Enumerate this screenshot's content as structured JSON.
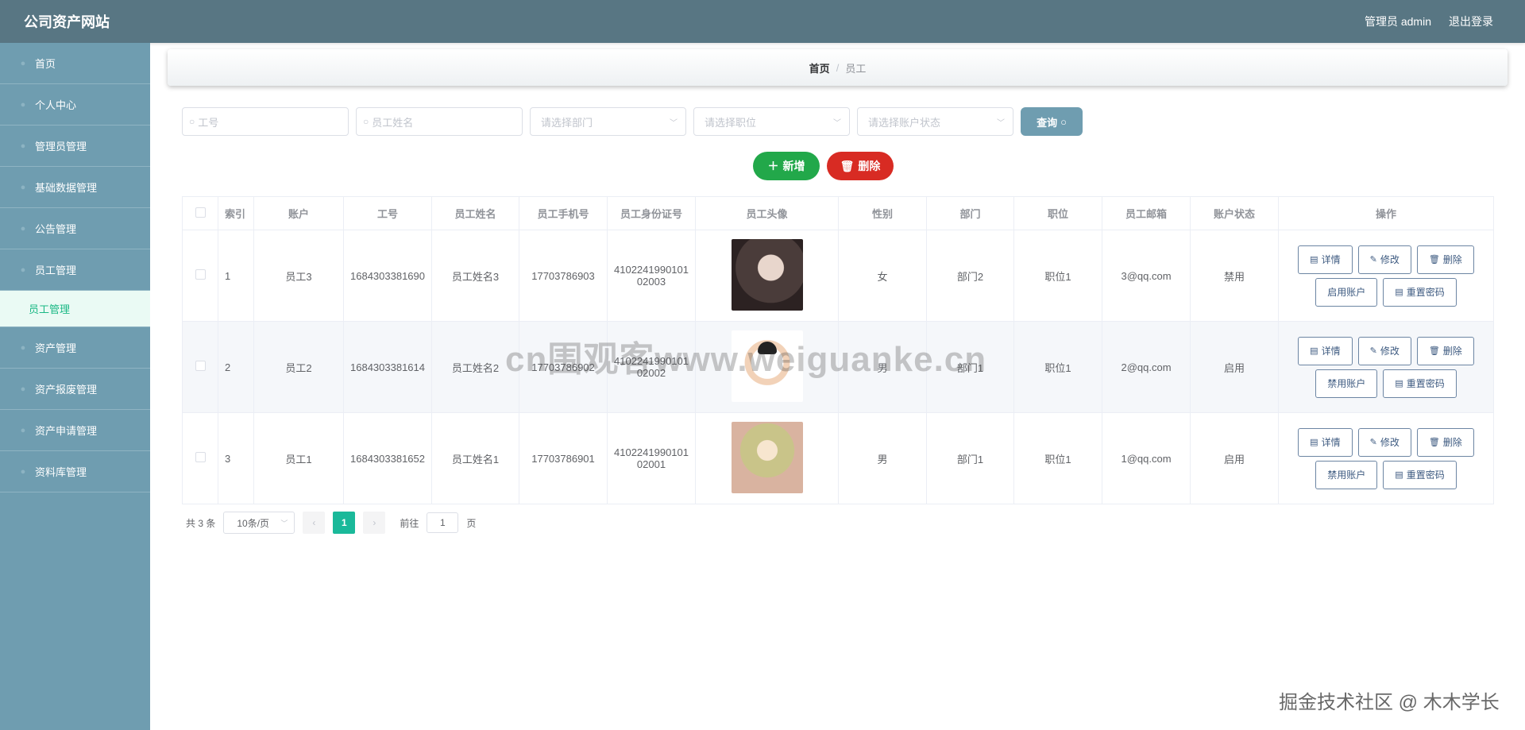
{
  "header": {
    "title": "公司资产网站",
    "user_label": "管理员 admin",
    "logout_label": "退出登录"
  },
  "sidebar": {
    "items": [
      {
        "label": "首页"
      },
      {
        "label": "个人中心"
      },
      {
        "label": "管理员管理"
      },
      {
        "label": "基础数据管理"
      },
      {
        "label": "公告管理"
      },
      {
        "label": "员工管理"
      },
      {
        "label": "员工管理",
        "sub": true
      },
      {
        "label": "资产管理"
      },
      {
        "label": "资产报废管理"
      },
      {
        "label": "资产申请管理"
      },
      {
        "label": "资料库管理"
      }
    ]
  },
  "breadcrumb": {
    "home": "首页",
    "separator": "/",
    "current": "员工"
  },
  "filters": {
    "employee_no_placeholder": "工号",
    "employee_name_placeholder": "员工姓名",
    "department_placeholder": "请选择部门",
    "position_placeholder": "请选择职位",
    "status_placeholder": "请选择账户状态",
    "query_label": "查询"
  },
  "actions": {
    "add_label": "新增",
    "delete_label": "删除"
  },
  "table": {
    "columns": [
      "索引",
      "账户",
      "工号",
      "员工姓名",
      "员工手机号",
      "员工身份证号",
      "员工头像",
      "性别",
      "部门",
      "职位",
      "员工邮箱",
      "账户状态",
      "操作"
    ],
    "rows": [
      {
        "index": "1",
        "account": "员工3",
        "employee_no": "1684303381690",
        "name": "员工姓名3",
        "phone": "17703786903",
        "id_card_1": "4102241990101",
        "id_card_2": "02003",
        "gender": "女",
        "department": "部门2",
        "position": "职位1",
        "email": "3@qq.com",
        "status": "禁用",
        "toggle_label": "启用账户"
      },
      {
        "index": "2",
        "account": "员工2",
        "employee_no": "1684303381614",
        "name": "员工姓名2",
        "phone": "17703786902",
        "id_card_1": "4102241990101",
        "id_card_2": "02002",
        "gender": "男",
        "department": "部门1",
        "position": "职位1",
        "email": "2@qq.com",
        "status": "启用",
        "toggle_label": "禁用账户"
      },
      {
        "index": "3",
        "account": "员工1",
        "employee_no": "1684303381652",
        "name": "员工姓名1",
        "phone": "17703786901",
        "id_card_1": "4102241990101",
        "id_card_2": "02001",
        "gender": "男",
        "department": "部门1",
        "position": "职位1",
        "email": "1@qq.com",
        "status": "启用",
        "toggle_label": "禁用账户"
      }
    ],
    "op_labels": {
      "detail": "详情",
      "edit": "修改",
      "delete": "删除",
      "reset": "重置密码"
    }
  },
  "pagination": {
    "total_text": "共 3 条",
    "page_size": "10条/页",
    "current_page": "1",
    "goto_prefix": "前往",
    "goto_value": "1",
    "goto_suffix": "页"
  },
  "watermark": "cn围观客www.weiguanke.cn",
  "footer_mark": "掘金技术社区 @ 木木学长"
}
